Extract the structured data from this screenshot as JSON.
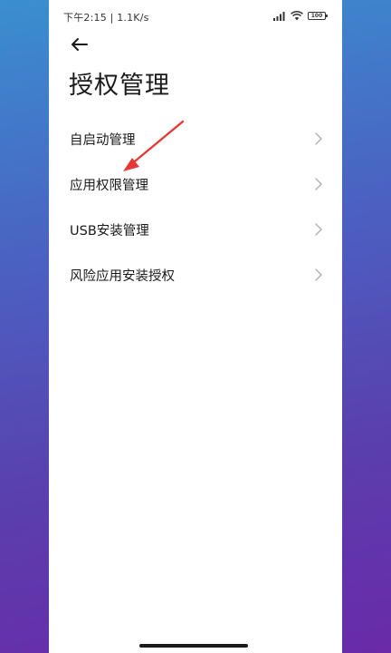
{
  "status_bar": {
    "time_speed": "下午2:15 | 1.1K/s",
    "battery_level": "100"
  },
  "header": {
    "title": "授权管理"
  },
  "menu": {
    "items": [
      {
        "label": "自启动管理"
      },
      {
        "label": "应用权限管理"
      },
      {
        "label": "USB安装管理"
      },
      {
        "label": "风险应用安装授权"
      }
    ]
  },
  "colors": {
    "annotation_arrow": "#e53935",
    "text_primary": "#1a1a1a",
    "chevron": "#b0b0b0"
  }
}
